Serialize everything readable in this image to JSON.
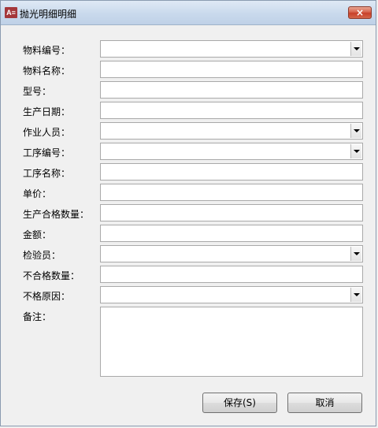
{
  "window": {
    "title": "抛光明细明细",
    "app_icon": "access-icon",
    "close_glyph": "×"
  },
  "form": {
    "fields": [
      {
        "label": "物料编号：",
        "value": "",
        "type": "combo"
      },
      {
        "label": "物料名称：",
        "value": "",
        "type": "text"
      },
      {
        "label": "型号：",
        "value": "",
        "type": "text"
      },
      {
        "label": "生产日期：",
        "value": "",
        "type": "text"
      },
      {
        "label": "作业人员：",
        "value": "",
        "type": "combo"
      },
      {
        "label": "工序编号：",
        "value": "",
        "type": "combo"
      },
      {
        "label": "工序名称：",
        "value": "",
        "type": "text"
      },
      {
        "label": "单价：",
        "value": "",
        "type": "text"
      },
      {
        "label": "生产合格数量：",
        "value": "",
        "type": "text"
      },
      {
        "label": "金额：",
        "value": "",
        "type": "text"
      },
      {
        "label": "检验员：",
        "value": "",
        "type": "combo"
      },
      {
        "label": "不合格数量：",
        "value": "",
        "type": "text"
      },
      {
        "label": "不格原因：",
        "value": "",
        "type": "combo"
      }
    ],
    "remark_label": "备注：",
    "remark_value": ""
  },
  "buttons": {
    "save_label": "保存(S)",
    "cancel_label": "取消"
  }
}
